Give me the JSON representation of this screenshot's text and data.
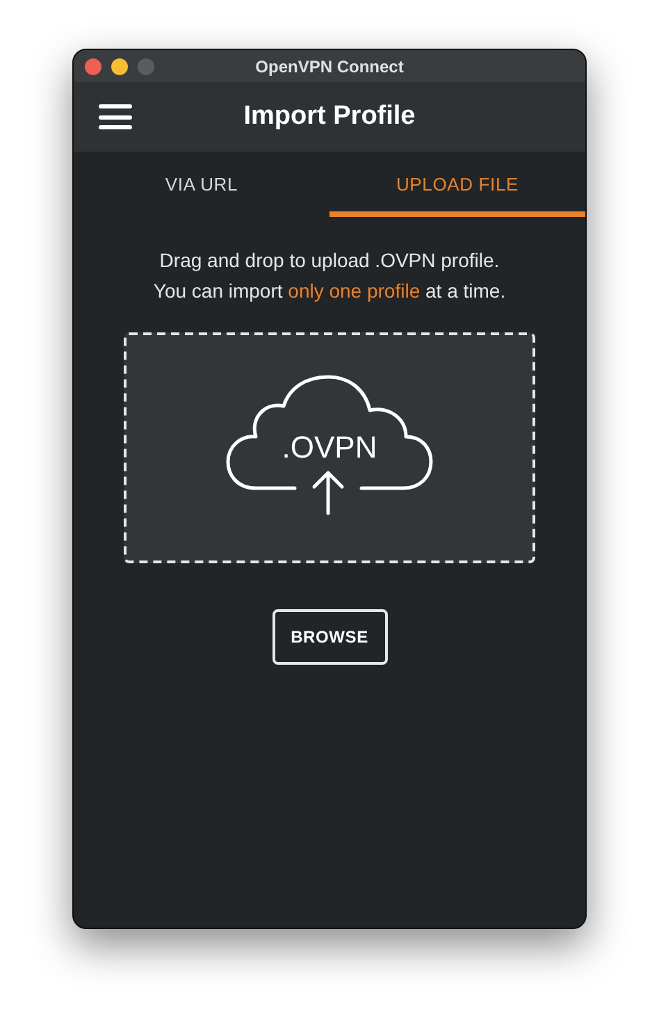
{
  "window": {
    "title": "OpenVPN Connect"
  },
  "header": {
    "title": "Import Profile"
  },
  "tabs": [
    {
      "label": "VIA URL",
      "selected": false
    },
    {
      "label": "UPLOAD FILE",
      "selected": true
    }
  ],
  "instructions": {
    "line_1": "Drag and drop to upload .OVPN profile.",
    "line_2_before": "You can import",
    "line_2_highlight": "only one profile",
    "line_2_after": "at a time."
  },
  "drop_zone": {
    "label": ".OVPN"
  },
  "browse_button": "BROWSE"
}
